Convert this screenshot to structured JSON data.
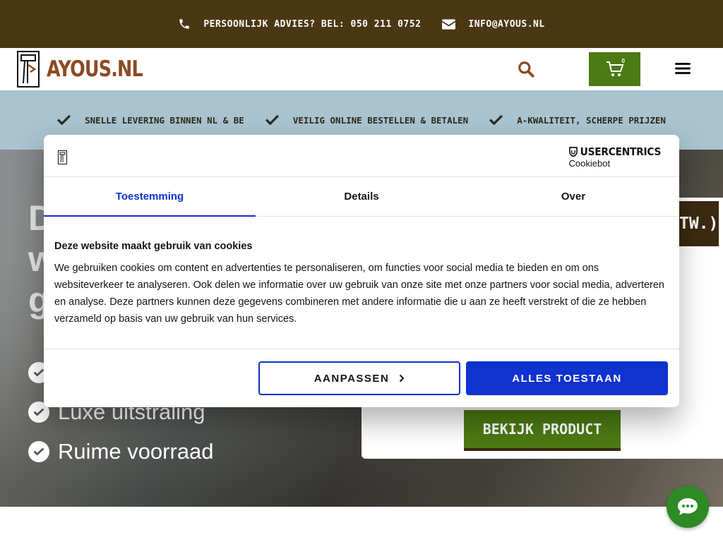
{
  "topbar": {
    "phone_text": "PERSOONLIJK ADVIES? BEL: 050 211 0752",
    "email_text": "INFO@AYOUS.NL"
  },
  "header": {
    "logo_text": "AYOUS.NL",
    "cart_count": "0"
  },
  "usps": [
    {
      "label": "SNELLE LEVERING BINNEN NL & BE"
    },
    {
      "label": "VEILIG ONLINE BESTELLEN & BETALEN"
    },
    {
      "label": "A-KWALITEIT, SCHERPE PRIJZEN"
    }
  ],
  "hero": {
    "title_lines": [
      "D",
      "w",
      "g"
    ],
    "list": [
      {
        "label": ""
      },
      {
        "label": "Luxe uitstraling"
      },
      {
        "label": "Ruime voorraad"
      }
    ],
    "card_label_fragment": "TW.)",
    "cta_label": "BEKIJK PRODUCT"
  },
  "cookie": {
    "brand_name": "USERCENTRICS",
    "brand_sub": "Cookiebot",
    "tabs": [
      {
        "label": "Toestemming"
      },
      {
        "label": "Details"
      },
      {
        "label": "Over"
      }
    ],
    "heading": "Deze website maakt gebruik van cookies",
    "body": "We gebruiken cookies om content en advertenties te personaliseren, om functies voor social media te bieden en om ons websiteverkeer te analyseren. Ook delen we informatie over uw gebruik van onze site met onze partners voor social media, adverteren en analyse. Deze partners kunnen deze gegevens combineren met andere informatie die u aan ze heeft verstrekt of die ze hebben verzameld op basis van uw gebruik van hun services.",
    "customize_label": "AANPASSEN",
    "allow_all_label": "ALLES TOESTAAN"
  },
  "colors": {
    "topbar_bg": "#4a3713",
    "brand_brown": "#8d4a22",
    "brand_green": "#4c7a13",
    "usp_bg": "#a9c3cf",
    "cookie_accent": "#1032cf",
    "chat_green": "#2d8a25"
  },
  "icons": {
    "phone": "phone-icon",
    "email": "envelope-icon",
    "search": "search-icon",
    "cart": "cart-icon",
    "menu": "hamburger-menu-icon",
    "check": "check-icon",
    "chat": "chat-bubble-icon"
  }
}
